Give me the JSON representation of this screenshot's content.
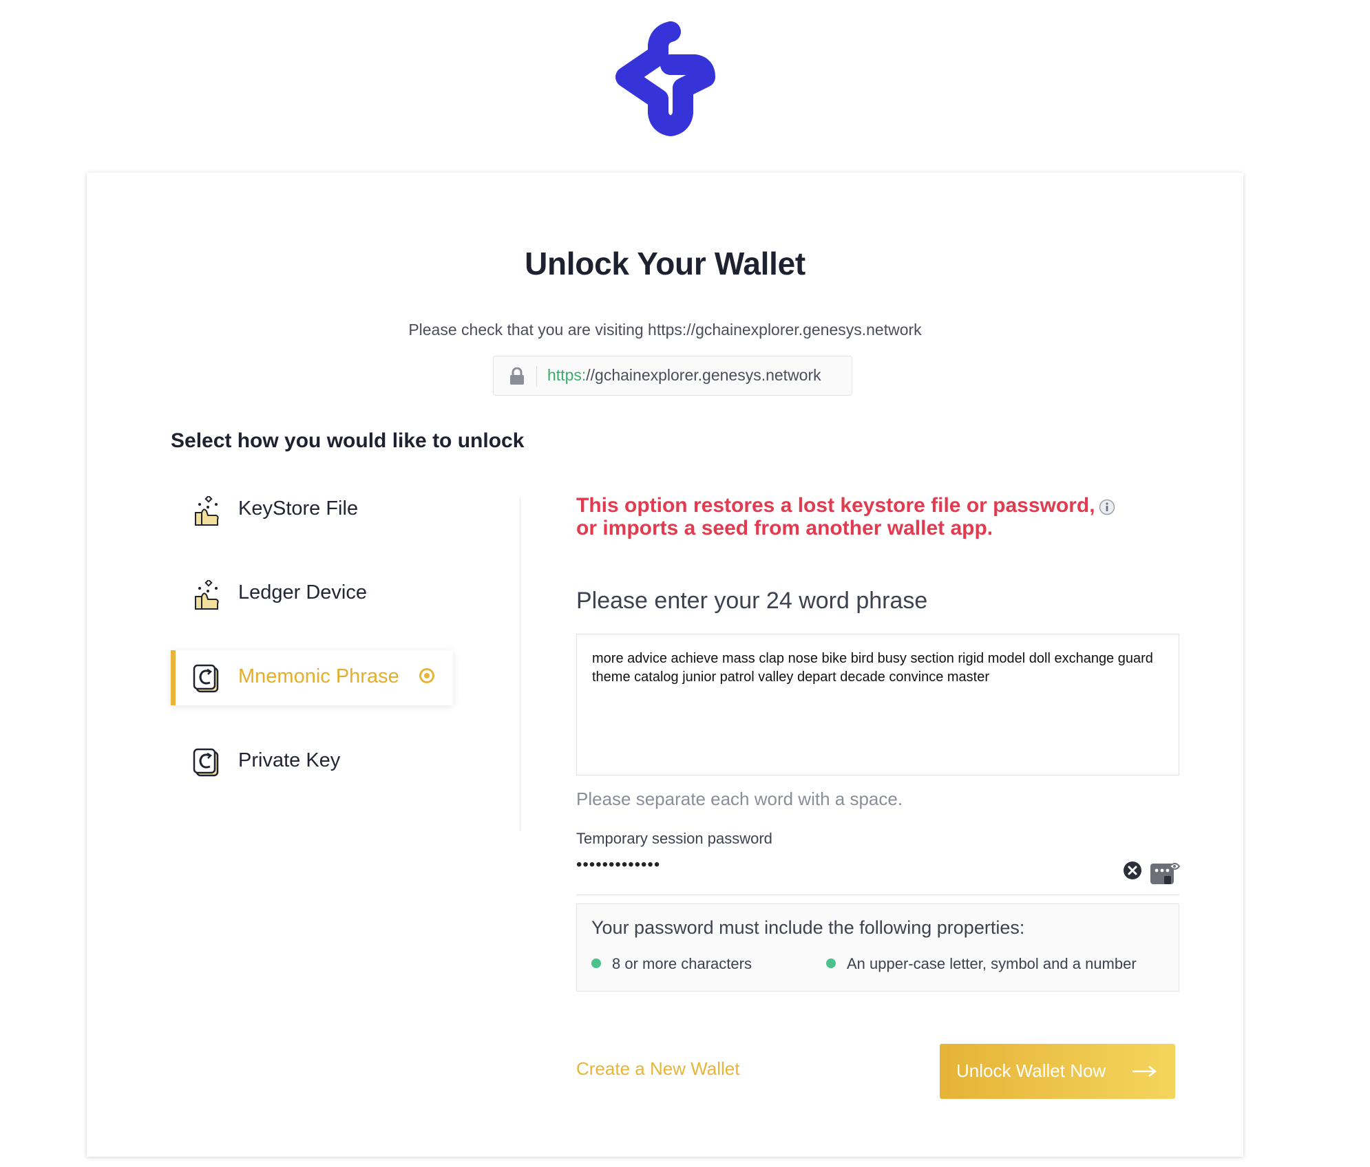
{
  "brand": {
    "logo_icon": "genesys-g-logo-icon",
    "color": "#3633d9"
  },
  "page": {
    "title": "Unlock Your Wallet",
    "verify_text": "Please check that you are visiting https://gchainexplorer.genesys.network",
    "url_protocol": "https:",
    "url_rest": "//gchainexplorer.genesys.network",
    "select_heading": "Select how you would like to unlock"
  },
  "options": [
    {
      "label": "KeyStore File",
      "icon": "keystore-icon",
      "selected": false
    },
    {
      "label": "Ledger Device",
      "icon": "ledger-icon",
      "selected": false
    },
    {
      "label": "Mnemonic Phrase",
      "icon": "mnemonic-icon",
      "selected": true
    },
    {
      "label": "Private Key",
      "icon": "private-key-icon",
      "selected": false
    }
  ],
  "mnemonic": {
    "warning_line1": "This option restores a lost keystore file or password,",
    "warning_line2": "or imports a seed from another wallet app.",
    "phrase_label": "Please enter your 24 word phrase",
    "phrase_value": "more advice achieve mass clap nose bike bird busy section rigid model doll exchange guard theme catalog junior patrol valley depart decade convince master",
    "hint": "Please separate each word with a space.",
    "password_label": "Temporary session password",
    "password_value": "•••••••••••••",
    "requirements_title": "Your password must include the following properties:",
    "requirements": [
      "8 or more characters",
      "An upper-case letter, symbol and a number"
    ],
    "requirement_status_color": "#4cc18a"
  },
  "actions": {
    "create_wallet": "Create a New Wallet",
    "unlock": "Unlock Wallet Now"
  },
  "colors": {
    "accent": "#e8b53a",
    "warning": "#e23a4e",
    "secure_green": "#3daa6f"
  }
}
